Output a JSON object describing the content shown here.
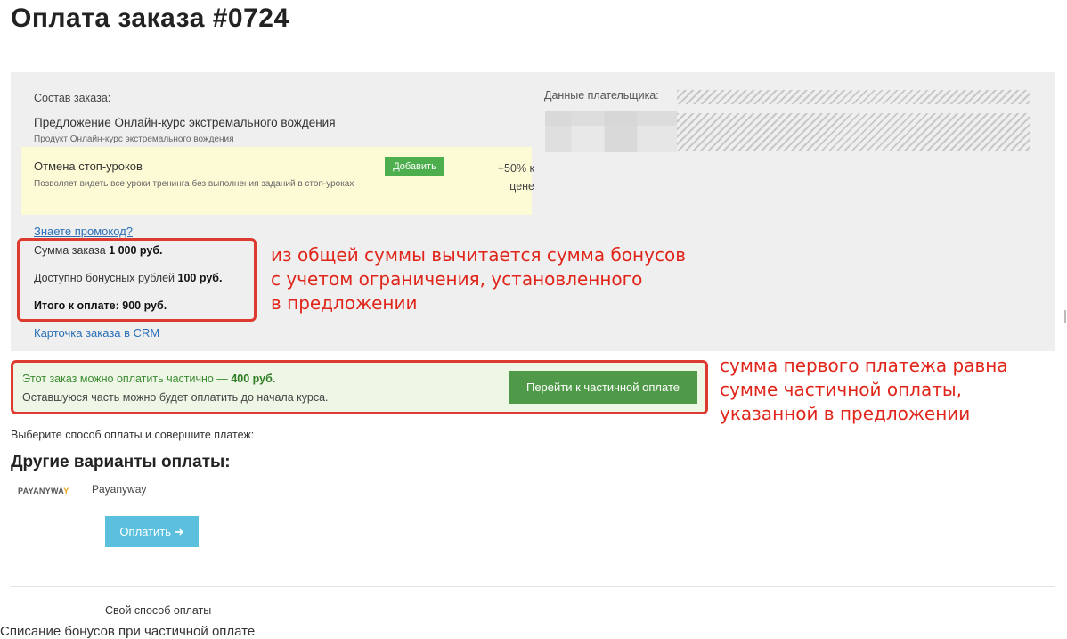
{
  "page": {
    "title": "Оплата заказа #0724"
  },
  "order": {
    "composition_label": "Состав заказа:",
    "offer_name": "Предложение Онлайн-курс экстремального вождения",
    "product_name": "Продукт Онлайн-курс экстремального вождения",
    "addon": {
      "name": "Отмена стоп-уроков",
      "description": "Позволяет видеть все уроки тренинга без выполнения заданий в стоп-уроках",
      "add_button": "Добавить",
      "price": "+50% к цене"
    },
    "promo_link": "Знаете промокод?",
    "sum_label": "Сумма заказа",
    "sum_value": "1 000 руб.",
    "bonus_label": "Доступно бонусных рублей",
    "bonus_value": "100 руб.",
    "total_text": "Итого к оплате: 900 руб.",
    "crm_link": "Карточка заказа в CRM"
  },
  "payer": {
    "title": "Данные плательщика:"
  },
  "partial": {
    "line1_prefix": "Этот заказ можно оплатить частично —",
    "line1_amount": "400 руб.",
    "line2": "Оставшуюся часть можно будет оплатить до начала курса.",
    "button": "Перейти к частичной оплате"
  },
  "payment": {
    "choose_text": "Выберите способ оплаты и совершите платеж:",
    "other_title": "Другие варианты оплаты:",
    "provider_logo_a": "PAYANYWA",
    "provider_logo_b": "Y",
    "provider_name": "Payanyway",
    "pay_button": "Оплатить",
    "own_method": "Свой способ оплаты"
  },
  "annotations": {
    "note1": "из общей суммы вычитается сумма бонусов\nс учетом ограничения, установленного\nв предложении",
    "note2": "сумма первого платежа равна\nсумме частичной оплаты,\nуказанной в предложении",
    "color": "#e0261b"
  },
  "caption": "Списание бонусов при частичной оплате"
}
